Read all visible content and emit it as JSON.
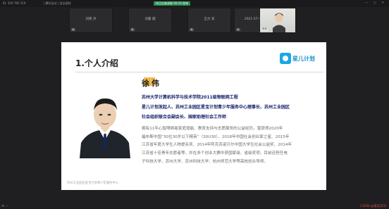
{
  "topbar": {
    "meeting_id": "ID: 350 785 519",
    "app_title": "| 腾讯会议 | 会议录制",
    "recording_badge": "你正在被录制 00:10 结束",
    "window_controls": "— ▢ ✕"
  },
  "participants": [
    {
      "name": "刘贺 声"
    },
    {
      "name": "刘嘉 圆"
    },
    {
      "name": "王力 军"
    },
    {
      "name": "2021 07 03 张学"
    }
  ],
  "camera_tile": {
    "name": "徐伟"
  },
  "slide": {
    "heading": "1.个人介绍",
    "logo_text": "星儿计划",
    "person_name": "徐伟",
    "title_lines": [
      "苏州大学计算机科学与技术学院2011级物联网工程",
      "星儿计划发起人、苏州工业园区星宝计划青少年服务中心理事长、苏州工业园区",
      "社会组织联合会副会长、国家助理社会工作师"
    ],
    "bio_lines": [
      "拥有11年心智障碍者家庭增能、教育支持与志愿服务的公益经历，曾获得2020年",
      "福布斯中国“30位30岁以下精英”（30U30）、2018年中国社会创业家之星、2015年",
      "江苏省年度大学生人物提名奖、2014年阿克苏诺贝尔中国大学生社会公益奖、2014年",
      "江苏省十佳青年志愿者等，并在多个创业大赛中获国家级、省级奖项。目前还担任电",
      "子科技大学、苏州大学、苏州科技大学、杭州师范大学等高校创业导师。"
    ],
    "footer": "苏州工业园区星宝计划青少年服务中心"
  },
  "bottombar": {
    "brand": "CSDN @喜美资讯",
    "left_icons": "≡ ⋯"
  },
  "colors": {
    "accent_name_highlight": "#f2b94a",
    "title_navy": "#14206b",
    "logo_blue": "#1ba7e4",
    "recording_green": "#2e8b57"
  }
}
